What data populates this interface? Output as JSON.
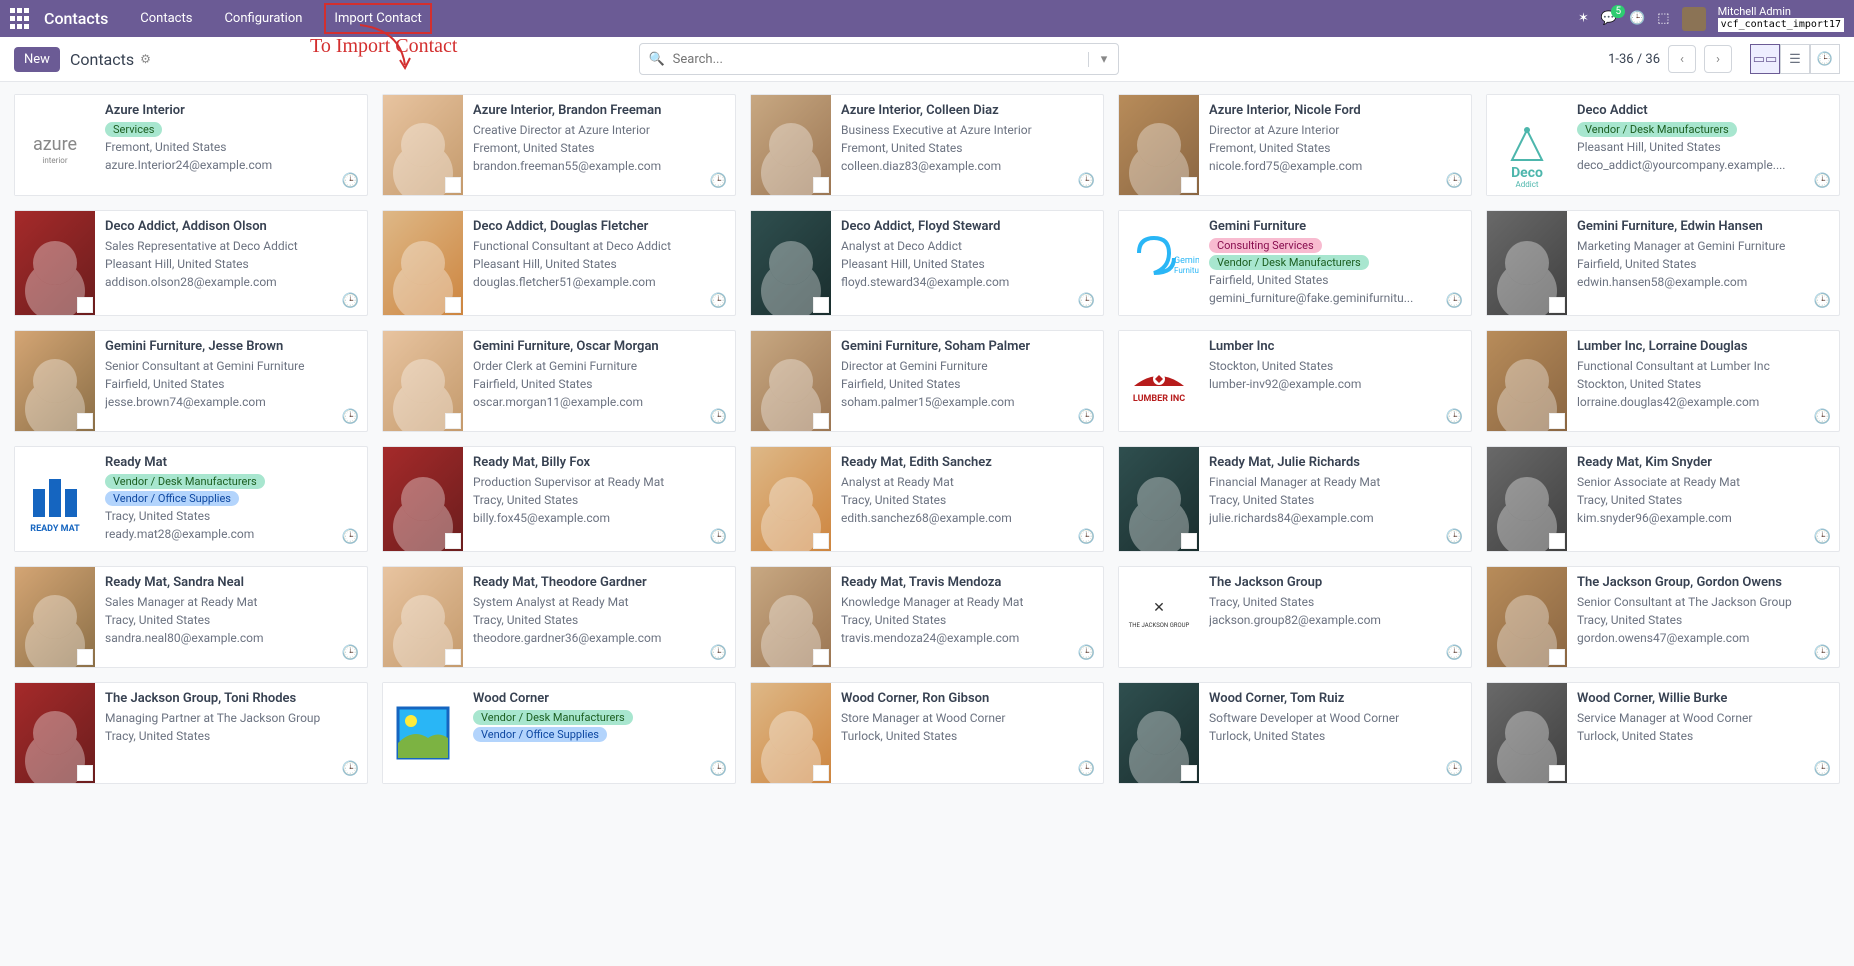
{
  "topbar": {
    "app_name": "Contacts",
    "nav": [
      "Contacts",
      "Configuration",
      "Import Contact"
    ],
    "msg_count": "5",
    "user_name": "Mitchell Admin",
    "module_tag": "vcf_contact_import17"
  },
  "subheader": {
    "new_label": "New",
    "breadcrumb": "Contacts",
    "search_placeholder": "Search...",
    "pager": "1-36 / 36"
  },
  "annotation": "To Import Contact",
  "contacts": [
    {
      "name": "Azure Interior",
      "tags": [
        {
          "text": "Services",
          "cls": "services"
        }
      ],
      "line1": "",
      "location": "Fremont, United States",
      "email": "azure.Interior24@example.com",
      "img": "company",
      "logo": "azure"
    },
    {
      "name": "Azure Interior, Brandon Freeman",
      "tags": [],
      "line1": "Creative Director at Azure Interior",
      "location": "Fremont, United States",
      "email": "brandon.freeman55@example.com",
      "img": "face-2",
      "sublogo": true
    },
    {
      "name": "Azure Interior, Colleen Diaz",
      "tags": [],
      "line1": "Business Executive at Azure Interior",
      "location": "Fremont, United States",
      "email": "colleen.diaz83@example.com",
      "img": "face-3",
      "sublogo": true
    },
    {
      "name": "Azure Interior, Nicole Ford",
      "tags": [],
      "line1": "Director at Azure Interior",
      "location": "Fremont, United States",
      "email": "nicole.ford75@example.com",
      "img": "face-4",
      "sublogo": true
    },
    {
      "name": "Deco Addict",
      "tags": [
        {
          "text": "Vendor / Desk Manufacturers",
          "cls": "vendor-desk"
        }
      ],
      "line1": "",
      "location": "Pleasant Hill, United States",
      "email": "deco_addict@yourcompany.example....",
      "img": "company",
      "logo": "deco"
    },
    {
      "name": "Deco Addict, Addison Olson",
      "tags": [],
      "line1": "Sales Representative at Deco Addict",
      "location": "Pleasant Hill, United States",
      "email": "addison.olson28@example.com",
      "img": "face-5",
      "sublogo": true
    },
    {
      "name": "Deco Addict, Douglas Fletcher",
      "tags": [],
      "line1": "Functional Consultant at Deco Addict",
      "location": "Pleasant Hill, United States",
      "email": "douglas.fletcher51@example.com",
      "img": "face-6",
      "sublogo": true
    },
    {
      "name": "Deco Addict, Floyd Steward",
      "tags": [],
      "line1": "Analyst at Deco Addict",
      "location": "Pleasant Hill, United States",
      "email": "floyd.steward34@example.com",
      "img": "face-7",
      "sublogo": true
    },
    {
      "name": "Gemini Furniture",
      "tags": [
        {
          "text": "Consulting Services",
          "cls": "consulting"
        },
        {
          "text": "Vendor / Desk Manufacturers",
          "cls": "vendor-desk"
        }
      ],
      "line1": "",
      "location": "Fairfield, United States",
      "email": "gemini_furniture@fake.geminifurnitu...",
      "img": "company",
      "logo": "gemini"
    },
    {
      "name": "Gemini Furniture, Edwin Hansen",
      "tags": [],
      "line1": "Marketing Manager at Gemini Furniture",
      "location": "Fairfield, United States",
      "email": "edwin.hansen58@example.com",
      "img": "face-8",
      "sublogo": true
    },
    {
      "name": "Gemini Furniture, Jesse Brown",
      "tags": [],
      "line1": "Senior Consultant at Gemini Furniture",
      "location": "Fairfield, United States",
      "email": "jesse.brown74@example.com",
      "img": "face-1",
      "sublogo": true
    },
    {
      "name": "Gemini Furniture, Oscar Morgan",
      "tags": [],
      "line1": "Order Clerk at Gemini Furniture",
      "location": "Fairfield, United States",
      "email": "oscar.morgan11@example.com",
      "img": "face-2",
      "sublogo": true
    },
    {
      "name": "Gemini Furniture, Soham Palmer",
      "tags": [],
      "line1": "Director at Gemini Furniture",
      "location": "Fairfield, United States",
      "email": "soham.palmer15@example.com",
      "img": "face-3",
      "sublogo": true
    },
    {
      "name": "Lumber Inc",
      "tags": [],
      "line1": "",
      "location": "Stockton, United States",
      "email": "lumber-inv92@example.com",
      "img": "company",
      "logo": "lumber"
    },
    {
      "name": "Lumber Inc, Lorraine Douglas",
      "tags": [],
      "line1": "Functional Consultant at Lumber Inc",
      "location": "Stockton, United States",
      "email": "lorraine.douglas42@example.com",
      "img": "face-4",
      "sublogo": true
    },
    {
      "name": "Ready Mat",
      "tags": [
        {
          "text": "Vendor / Desk Manufacturers",
          "cls": "vendor-desk"
        },
        {
          "text": "Vendor / Office Supplies",
          "cls": "office-supplies"
        }
      ],
      "line1": "",
      "location": "Tracy, United States",
      "email": "ready.mat28@example.com",
      "img": "company",
      "logo": "readymat"
    },
    {
      "name": "Ready Mat, Billy Fox",
      "tags": [],
      "line1": "Production Supervisor at Ready Mat",
      "location": "Tracy, United States",
      "email": "billy.fox45@example.com",
      "img": "face-5",
      "sublogo": true
    },
    {
      "name": "Ready Mat, Edith Sanchez",
      "tags": [],
      "line1": "Analyst at Ready Mat",
      "location": "Tracy, United States",
      "email": "edith.sanchez68@example.com",
      "img": "face-6",
      "sublogo": true
    },
    {
      "name": "Ready Mat, Julie Richards",
      "tags": [],
      "line1": "Financial Manager at Ready Mat",
      "location": "Tracy, United States",
      "email": "julie.richards84@example.com",
      "img": "face-7",
      "sublogo": true
    },
    {
      "name": "Ready Mat, Kim Snyder",
      "tags": [],
      "line1": "Senior Associate at Ready Mat",
      "location": "Tracy, United States",
      "email": "kim.snyder96@example.com",
      "img": "face-8",
      "sublogo": true
    },
    {
      "name": "Ready Mat, Sandra Neal",
      "tags": [],
      "line1": "Sales Manager at Ready Mat",
      "location": "Tracy, United States",
      "email": "sandra.neal80@example.com",
      "img": "face-1",
      "sublogo": true
    },
    {
      "name": "Ready Mat, Theodore Gardner",
      "tags": [],
      "line1": "System Analyst at Ready Mat",
      "location": "Tracy, United States",
      "email": "theodore.gardner36@example.com",
      "img": "face-2",
      "sublogo": true
    },
    {
      "name": "Ready Mat, Travis Mendoza",
      "tags": [],
      "line1": "Knowledge Manager at Ready Mat",
      "location": "Tracy, United States",
      "email": "travis.mendoza24@example.com",
      "img": "face-3",
      "sublogo": true
    },
    {
      "name": "The Jackson Group",
      "tags": [],
      "line1": "",
      "location": "Tracy, United States",
      "email": "jackson.group82@example.com",
      "img": "company",
      "logo": "jackson"
    },
    {
      "name": "The Jackson Group, Gordon Owens",
      "tags": [],
      "line1": "Senior Consultant at The Jackson Group",
      "location": "Tracy, United States",
      "email": "gordon.owens47@example.com",
      "img": "face-4",
      "sublogo": true
    },
    {
      "name": "The Jackson Group, Toni Rhodes",
      "tags": [],
      "line1": "Managing Partner at The Jackson Group",
      "location": "Tracy, United States",
      "email": "",
      "img": "face-5",
      "sublogo": true
    },
    {
      "name": "Wood Corner",
      "tags": [
        {
          "text": "Vendor / Desk Manufacturers",
          "cls": "vendor-desk"
        },
        {
          "text": "Vendor / Office Supplies",
          "cls": "office-supplies"
        }
      ],
      "line1": "",
      "location": "",
      "email": "",
      "img": "company",
      "logo": "wood"
    },
    {
      "name": "Wood Corner, Ron Gibson",
      "tags": [],
      "line1": "Store Manager at Wood Corner",
      "location": "Turlock, United States",
      "email": "",
      "img": "face-6",
      "sublogo": true
    },
    {
      "name": "Wood Corner, Tom Ruiz",
      "tags": [],
      "line1": "Software Developer at Wood Corner",
      "location": "Turlock, United States",
      "email": "",
      "img": "face-7",
      "sublogo": true
    },
    {
      "name": "Wood Corner, Willie Burke",
      "tags": [],
      "line1": "Service Manager at Wood Corner",
      "location": "Turlock, United States",
      "email": "",
      "img": "face-8",
      "sublogo": true
    }
  ]
}
